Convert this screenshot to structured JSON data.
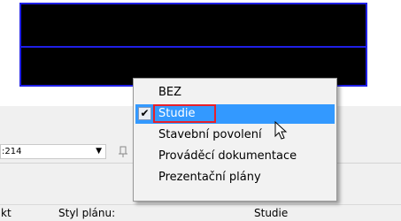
{
  "colors": {
    "viewport_frame": "#1f1fe6",
    "highlight": "#3399ff",
    "red_box": "#e8202a"
  },
  "toolbar": {
    "scale_value": ":214",
    "dropdown_arrow": "▼",
    "pin_icon": "pin-icon"
  },
  "context_menu": {
    "items": [
      {
        "label": "BEZ",
        "checked": false,
        "highlighted": false
      },
      {
        "label": "Studie",
        "checked": true,
        "highlighted": true
      },
      {
        "label": "Stavební povolení",
        "checked": false,
        "highlighted": false
      },
      {
        "label": "Prováděcí dokumentace",
        "checked": false,
        "highlighted": false
      },
      {
        "label": "Prezentační plány",
        "checked": false,
        "highlighted": false
      }
    ],
    "check_mark": "✔"
  },
  "properties_row": {
    "col1": "kt",
    "col2": "Styl plánu:",
    "col3": "Studie"
  }
}
